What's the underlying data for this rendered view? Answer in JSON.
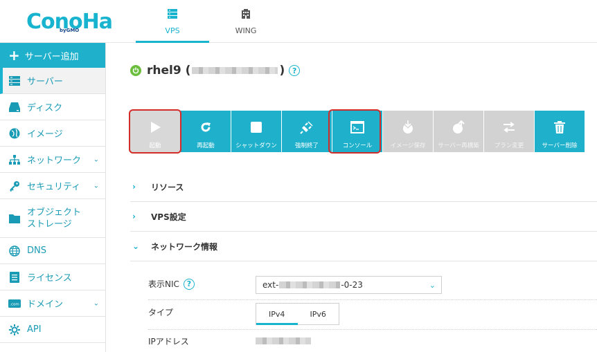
{
  "header": {
    "logo_text": "ConoHa",
    "logo_by": "by",
    "logo_brand": "GMO",
    "tabs": [
      {
        "label": "VPS",
        "icon": "server-stack-icon",
        "active": true
      },
      {
        "label": "WING",
        "icon": "wing-building-icon",
        "active": false
      }
    ]
  },
  "sidebar": {
    "add_server": "サーバー追加",
    "items": [
      {
        "label": "サーバー",
        "icon": "server-icon"
      },
      {
        "label": "ディスク",
        "icon": "disk-icon"
      },
      {
        "label": "イメージ",
        "icon": "globe-icon"
      },
      {
        "label": "ネットワーク",
        "icon": "network-icon"
      },
      {
        "label": "セキュリティ",
        "icon": "key-icon"
      },
      {
        "label_line1": "オブジェクト",
        "label_line2": "ストレージ",
        "icon": "folder-icon"
      },
      {
        "label": "DNS",
        "icon": "dns-globe-icon"
      },
      {
        "label": "ライセンス",
        "icon": "license-icon"
      },
      {
        "label": "ドメイン",
        "icon": "domain-icon"
      },
      {
        "label": "API",
        "icon": "api-icon"
      }
    ]
  },
  "server": {
    "name": "rhel9",
    "paren_open": "(",
    "paren_close": ")"
  },
  "actions": [
    {
      "label": "起動",
      "icon": "play-icon",
      "state": "start"
    },
    {
      "label": "再起動",
      "icon": "restart-icon",
      "state": "enabled"
    },
    {
      "label": "シャットダウン",
      "icon": "stop-icon",
      "state": "enabled"
    },
    {
      "label": "強制終了",
      "icon": "plug-icon",
      "state": "enabled"
    },
    {
      "label": "コンソール",
      "icon": "console-icon",
      "state": "enabled"
    },
    {
      "label": "イメージ保存",
      "icon": "image-save-icon",
      "state": "disabled"
    },
    {
      "label": "サーバー再構築",
      "icon": "rebuild-icon",
      "state": "disabled"
    },
    {
      "label": "プラン変更",
      "icon": "plan-change-icon",
      "state": "disabled"
    },
    {
      "label": "サーバー削除",
      "icon": "trash-icon",
      "state": "enabled"
    }
  ],
  "sections": [
    {
      "label": "リソース",
      "expanded": false
    },
    {
      "label": "VPS設定",
      "expanded": false
    },
    {
      "label": "ネットワーク情報",
      "expanded": true
    }
  ],
  "network": {
    "nic_label": "表示NIC",
    "nic_prefix": "ext-",
    "nic_suffix": "-0-23",
    "type_label": "タイプ",
    "type_options": [
      "IPv4",
      "IPv6"
    ],
    "type_selected": "IPv4",
    "ip_label": "IPアドレス"
  },
  "colors": {
    "accent": "#1fb1cc",
    "disabled": "#d2d2d2",
    "highlight": "#d32a2a",
    "power_on": "#6cbf3e"
  }
}
